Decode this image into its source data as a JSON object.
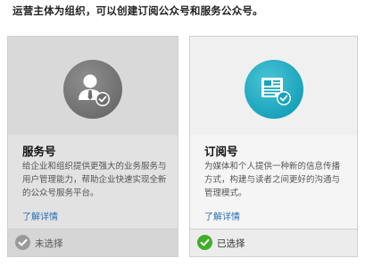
{
  "intro": "运营主体为组织，可以创建订阅公众号和服务公众号。",
  "cards": [
    {
      "title": "服务号",
      "icon": "service-account-person-icon",
      "description": "给企业和组织提供更强大的业务服务与用户管理能力，帮助企业快速实现全新的公众号服务平台。",
      "link": "了解详情",
      "status": "未选择",
      "accent": "#6e6e6e"
    },
    {
      "title": "订阅号",
      "icon": "subscription-account-document-icon",
      "description": "为媒体和个人提供一种新的信息传播方式，构建与读者之间更好的沟通与管理模式。",
      "link": "了解详情",
      "status": "已选择",
      "accent": "#1aa3bb"
    }
  ],
  "colors": {
    "link": "#2a6fb0",
    "selected": "#3fae2a",
    "unselected": "#9a9a9a"
  }
}
